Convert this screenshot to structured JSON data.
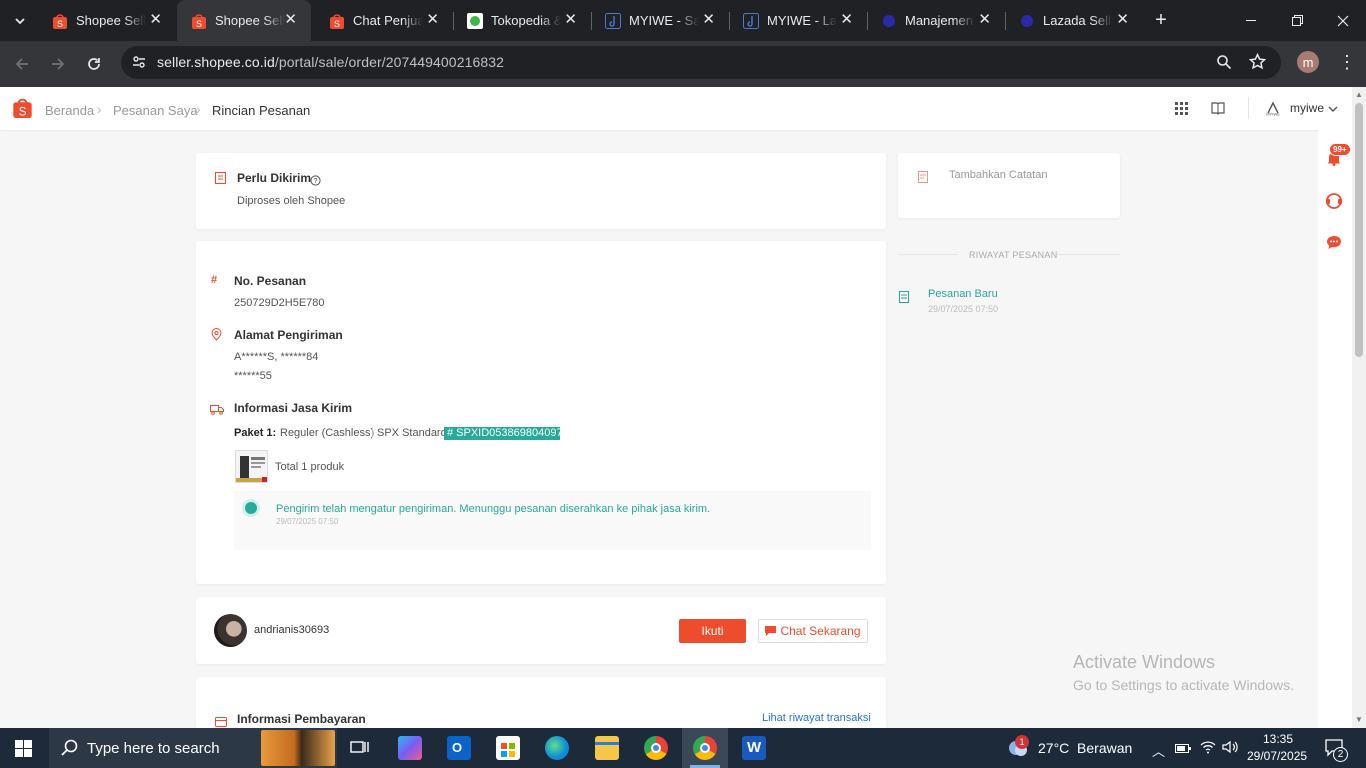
{
  "browser": {
    "tabs": [
      {
        "title": "Shopee Seller",
        "active": false
      },
      {
        "title": "Shopee Seller",
        "active": true
      },
      {
        "title": "Chat Penjual",
        "active": false
      },
      {
        "title": "Tokopedia & ",
        "active": false
      },
      {
        "title": "MYIWE - Sales",
        "active": false
      },
      {
        "title": "MYIWE - Lap",
        "active": false
      },
      {
        "title": "Manajemen",
        "active": false
      },
      {
        "title": "Lazada Seller",
        "active": false
      }
    ],
    "url_host": "seller.shopee.co.id",
    "url_path": "/portal/sale/order/207449400216832",
    "profile_initial": "m"
  },
  "header": {
    "breadcrumb": [
      "Beranda",
      "Pesanan Saya",
      "Rincian Pesanan"
    ],
    "shop_name": "myiwe"
  },
  "status_card": {
    "title": "Perlu Dikirim",
    "subtitle": "Diproses oleh Shopee"
  },
  "note_card": {
    "label": "Tambahkan Catatan"
  },
  "history": {
    "heading": "RIWAYAT PESANAN",
    "items": [
      {
        "label": "Pesanan Baru",
        "time": "29/07/2025 07:50"
      }
    ]
  },
  "order": {
    "number_label": "No. Pesanan",
    "number": "250729D2H5E780",
    "address_label": "Alamat Pengiriman",
    "address_line1": "A******S, ******84",
    "address_line2": "******55",
    "shipping_label": "Informasi Jasa Kirim",
    "package_label": "Paket 1:",
    "package_service": "Reguler (Cashless)",
    "package_courier": "SPX Standard",
    "tracking": "# SPXID053869804097",
    "product_count": "Total 1 produk",
    "track_status": "Pengirim telah mengatur pengiriman. Menunggu pesanan diserahkan ke pihak jasa kirim.",
    "track_time": "29/07/2025 07:50"
  },
  "buyer": {
    "username": "andrianis30693",
    "follow_label": "Ikuti",
    "chat_label": "Chat Sekarang"
  },
  "payment": {
    "title": "Informasi Pembayaran",
    "link": "Lihat riwayat transaksi"
  },
  "side_badge": "99+",
  "watermark": {
    "line1": "Activate Windows",
    "line2": "Go to Settings to activate Windows."
  },
  "taskbar": {
    "search_placeholder": "Type here to search",
    "weather": "27°C  Berawan",
    "time": "13:35",
    "date": "29/07/2025",
    "notif_count": "2"
  },
  "colors": {
    "accent": "#ee4d2d",
    "teal": "#26aa99",
    "chrome_dark": "#202124"
  }
}
